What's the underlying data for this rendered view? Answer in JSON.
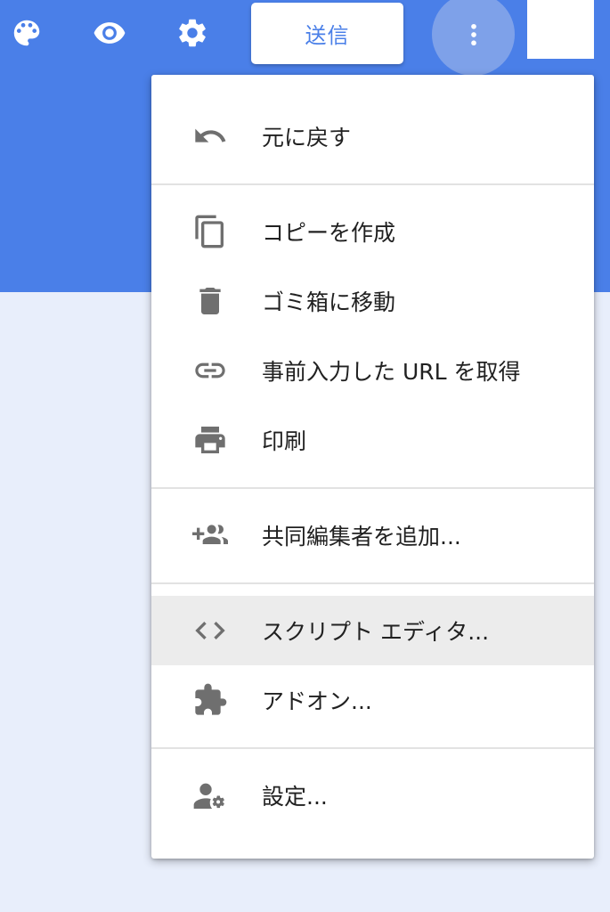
{
  "colors": {
    "brand_blue": "#4a7fe8",
    "page_background": "#e8eefb",
    "menu_highlight": "#ececec",
    "icon_gray": "#6f6f6f"
  },
  "toolbar": {
    "icons": [
      "palette-icon",
      "eye-icon",
      "gear-icon",
      "more-vert-icon"
    ],
    "send_label": "送信"
  },
  "menu": {
    "items": [
      {
        "label": "元に戻す",
        "icon": "undo-icon"
      },
      {
        "label": "コピーを作成",
        "icon": "copy-icon"
      },
      {
        "label": "ゴミ箱に移動",
        "icon": "trash-icon"
      },
      {
        "label": "事前入力した URL を取得",
        "icon": "link-icon"
      },
      {
        "label": "印刷",
        "icon": "print-icon"
      },
      {
        "label": "共同編集者を追加...",
        "icon": "add-people-icon"
      },
      {
        "label": "スクリプト エディタ...",
        "icon": "code-icon",
        "highlighted": true
      },
      {
        "label": "アドオン...",
        "icon": "puzzle-icon"
      },
      {
        "label": "設定...",
        "icon": "person-gear-icon"
      }
    ]
  }
}
